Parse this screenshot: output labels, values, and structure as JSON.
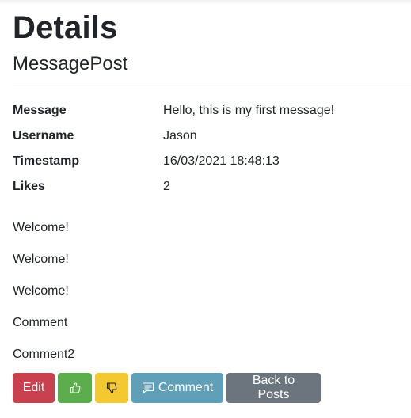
{
  "page": {
    "title": "Details",
    "subtitle": "MessagePost"
  },
  "details": [
    {
      "term": "Message",
      "value": "Hello, this is my first message!"
    },
    {
      "term": "Username",
      "value": "Jason"
    },
    {
      "term": "Timestamp",
      "value": "16/03/2021 18:48:13"
    },
    {
      "term": "Likes",
      "value": "2"
    }
  ],
  "comments": [
    "Welcome!",
    "Welcome!",
    "Welcome!",
    "Comment",
    "Comment2"
  ],
  "actions": {
    "edit_label": "Edit",
    "like_icon": "thumbs-up-icon",
    "dislike_icon": "thumbs-down-icon",
    "comment_icon": "chat-icon",
    "comment_label": "Comment",
    "back_label": "Back to Posts"
  },
  "colors": {
    "danger": "#c9404e",
    "success": "#5cad4b",
    "warning": "#f3c830",
    "info": "#5f9fb8",
    "secondary": "#6c757d"
  }
}
